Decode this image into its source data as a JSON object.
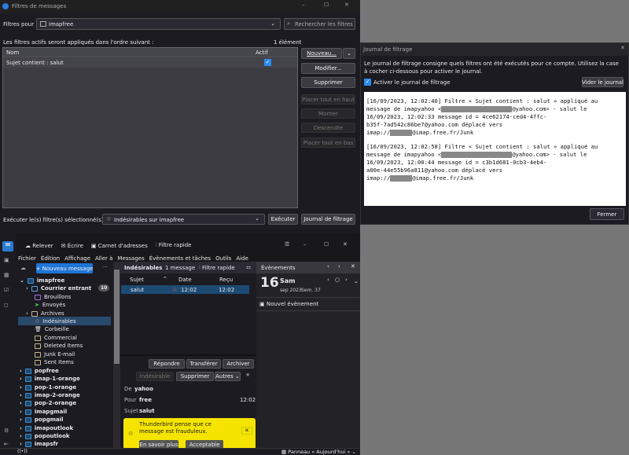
{
  "filter_dialog": {
    "title": "Filtres de messages",
    "filters_for_label": "Filtres pour :",
    "account": "imapfree",
    "search_placeholder": "Rechercher les filtres par",
    "order_text": "Les filtres actifs seront appliqués dans l'ordre suivant :",
    "count": "1 élément",
    "col_name": "Nom",
    "col_active": "Actif",
    "filters": [
      {
        "name": "Sujet contient : salut",
        "active": true
      }
    ],
    "buttons": {
      "new": "Nouveau...",
      "edit": "Modifier...",
      "delete": "Supprimer",
      "top": "Placer tout en haut",
      "up": "Monter",
      "down": "Descendre",
      "bottom": "Placer tout en bas",
      "run": "Exécuter",
      "log": "Journal de filtrage"
    },
    "run_on_label": "Exécuter le(s) filtre(s) sélectionné(s) sur :",
    "run_on_folder": "Indésirables sur imapfree"
  },
  "journal": {
    "title": "Journal de filtrage",
    "description": "Le journal de filtrage consigne quels filtres ont été exécutés pour ce compte. Utilisez la case à cocher ci-dessous pour activer le journal.",
    "enable_label": "Activer le journal de filtrage",
    "enabled": true,
    "clear_button": "Vider le journal",
    "close_button": "Fermer",
    "entries": [
      {
        "l1": "[16/09/2023, 12:02:40] Filtre « Sujet contient : salut » appliqué au",
        "l2a": "message de imapyahoo <",
        "l2b": "@yahoo.com> - salut le",
        "l3": "16/09/2023, 12:02:33 message id = 4ce62174-ced4-4ffc-",
        "l4": "b35f-7ad542c86be7@yahoo.com déplacé vers",
        "l5a": "imap://",
        "l5b": "@imap.free.fr/Junk"
      },
      {
        "l1": "[16/09/2023, 12:02:58] Filtre « Sujet contient : salut » appliqué au",
        "l2a": "message de imapyahoo <",
        "l2b": "@yahoo.com> - salut le",
        "l3": "16/09/2023, 12:00:44 message id = c3b1d681-0cb3-4eb4-",
        "l4": "a00e-44e55b96a811@yahoo.com déplacé vers",
        "l5a": "imap://",
        "l5b": "@imap.free.fr/Junk"
      }
    ]
  },
  "thunderbird": {
    "toolbar": {
      "get": "Relever",
      "write": "Écrire",
      "address_book": "Carnet d'adresses",
      "quick_filter": "Filtre rapide"
    },
    "menu": [
      "Fichier",
      "Édition",
      "Affichage",
      "Aller à",
      "Messages",
      "Évènements et tâches",
      "Outils",
      "Aide"
    ],
    "new_message": "+ Nouveau message",
    "account": "imapfree",
    "folders": [
      {
        "name": "Courrier entrant",
        "badge": "10"
      },
      {
        "name": "Brouillons"
      },
      {
        "name": "Envoyés"
      },
      {
        "name": "Archives"
      },
      {
        "name": "Indésirables",
        "selected": true
      },
      {
        "name": "Corbeille"
      },
      {
        "name": "Commercial"
      },
      {
        "name": "Deleted Items"
      },
      {
        "name": "Junk E-mail"
      },
      {
        "name": "Sent Items"
      }
    ],
    "accounts": [
      "popfree",
      "imap-1-orange",
      "pop-1-orange",
      "imap-2-orange",
      "pop-2-orange",
      "imapgmail",
      "popgmail",
      "imapoutlook",
      "popoutlook",
      "imapsfr"
    ],
    "list": {
      "folder": "Indésirables",
      "count": "1 message",
      "quick_filter": "Filtre rapide",
      "cols": {
        "subject": "Sujet",
        "date": "Date",
        "received": "Reçu"
      },
      "rows": [
        {
          "subject": "salut",
          "date": "12:02",
          "received": "12:02"
        }
      ]
    },
    "message": {
      "reply": "Répondre",
      "forward": "Transférer",
      "archive": "Archiver",
      "junk": "Indésirable",
      "delete": "Supprimer",
      "other": "Autres",
      "from_label": "De",
      "from": "yahoo",
      "to_label": "Pour",
      "to": "free",
      "time": "12:02",
      "subject_label": "Sujet",
      "subject": "salut",
      "scam_text": "Thunderbird pense que ce message est frauduleux.",
      "learn_more": "En savoir plus",
      "acceptable": "Acceptable"
    },
    "calendar": {
      "title": "Évènements",
      "day": "16",
      "weekday": "Sam",
      "month_year": "sep 2023",
      "week": "Sem. 37",
      "new_event": "Nouvel évènement"
    },
    "status": {
      "today_pane": "Panneau « Aujourd'hui »"
    }
  }
}
